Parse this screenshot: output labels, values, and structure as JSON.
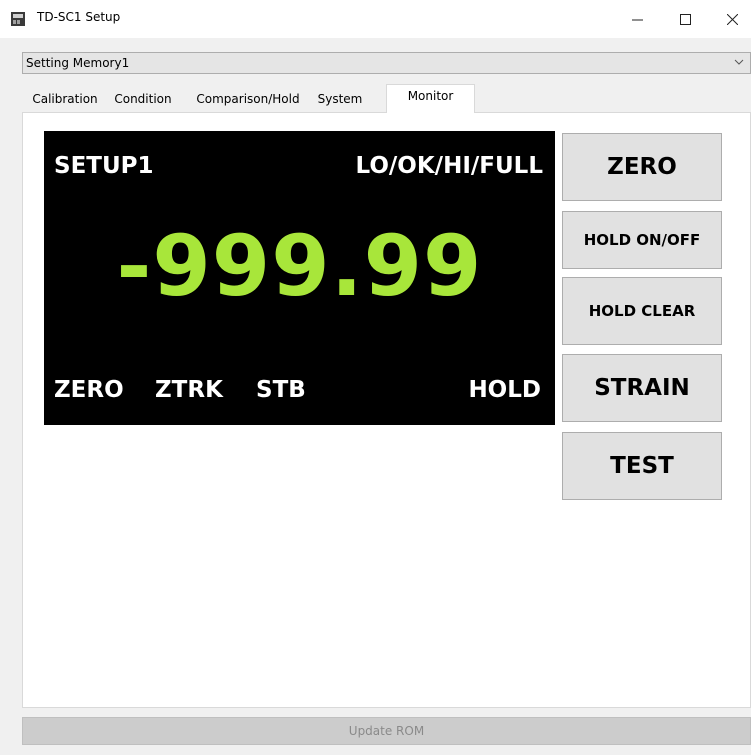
{
  "window": {
    "title": "TD-SC1 Setup",
    "icons": [
      "app-icon",
      "minimize-icon",
      "maximize-icon",
      "close-icon"
    ]
  },
  "memory_select": {
    "value": "Setting Memory1"
  },
  "tabs": [
    {
      "label": "Calibration",
      "selected": false
    },
    {
      "label": "Condition",
      "selected": false
    },
    {
      "label": "Comparison/Hold",
      "selected": false
    },
    {
      "label": "System",
      "selected": false
    },
    {
      "label": "Monitor",
      "selected": true
    }
  ],
  "monitor": {
    "setup_label": "SETUP1",
    "judgement": "LO/OK/HI/FULL",
    "value": "-999.99",
    "status": {
      "zero": "ZERO",
      "ztrk": "ZTRK",
      "stb": "STB",
      "hold": "HOLD"
    },
    "colors": {
      "display_bg": "#000000",
      "value_color": "#a8e63a",
      "text_color": "#ffffff"
    }
  },
  "buttons": {
    "zero": "ZERO",
    "hold_on_off": "HOLD ON/OFF",
    "hold_clear": "HOLD CLEAR",
    "strain": "STRAIN",
    "test": "TEST"
  },
  "footer": {
    "update_rom": "Update ROM",
    "update_rom_enabled": false
  }
}
